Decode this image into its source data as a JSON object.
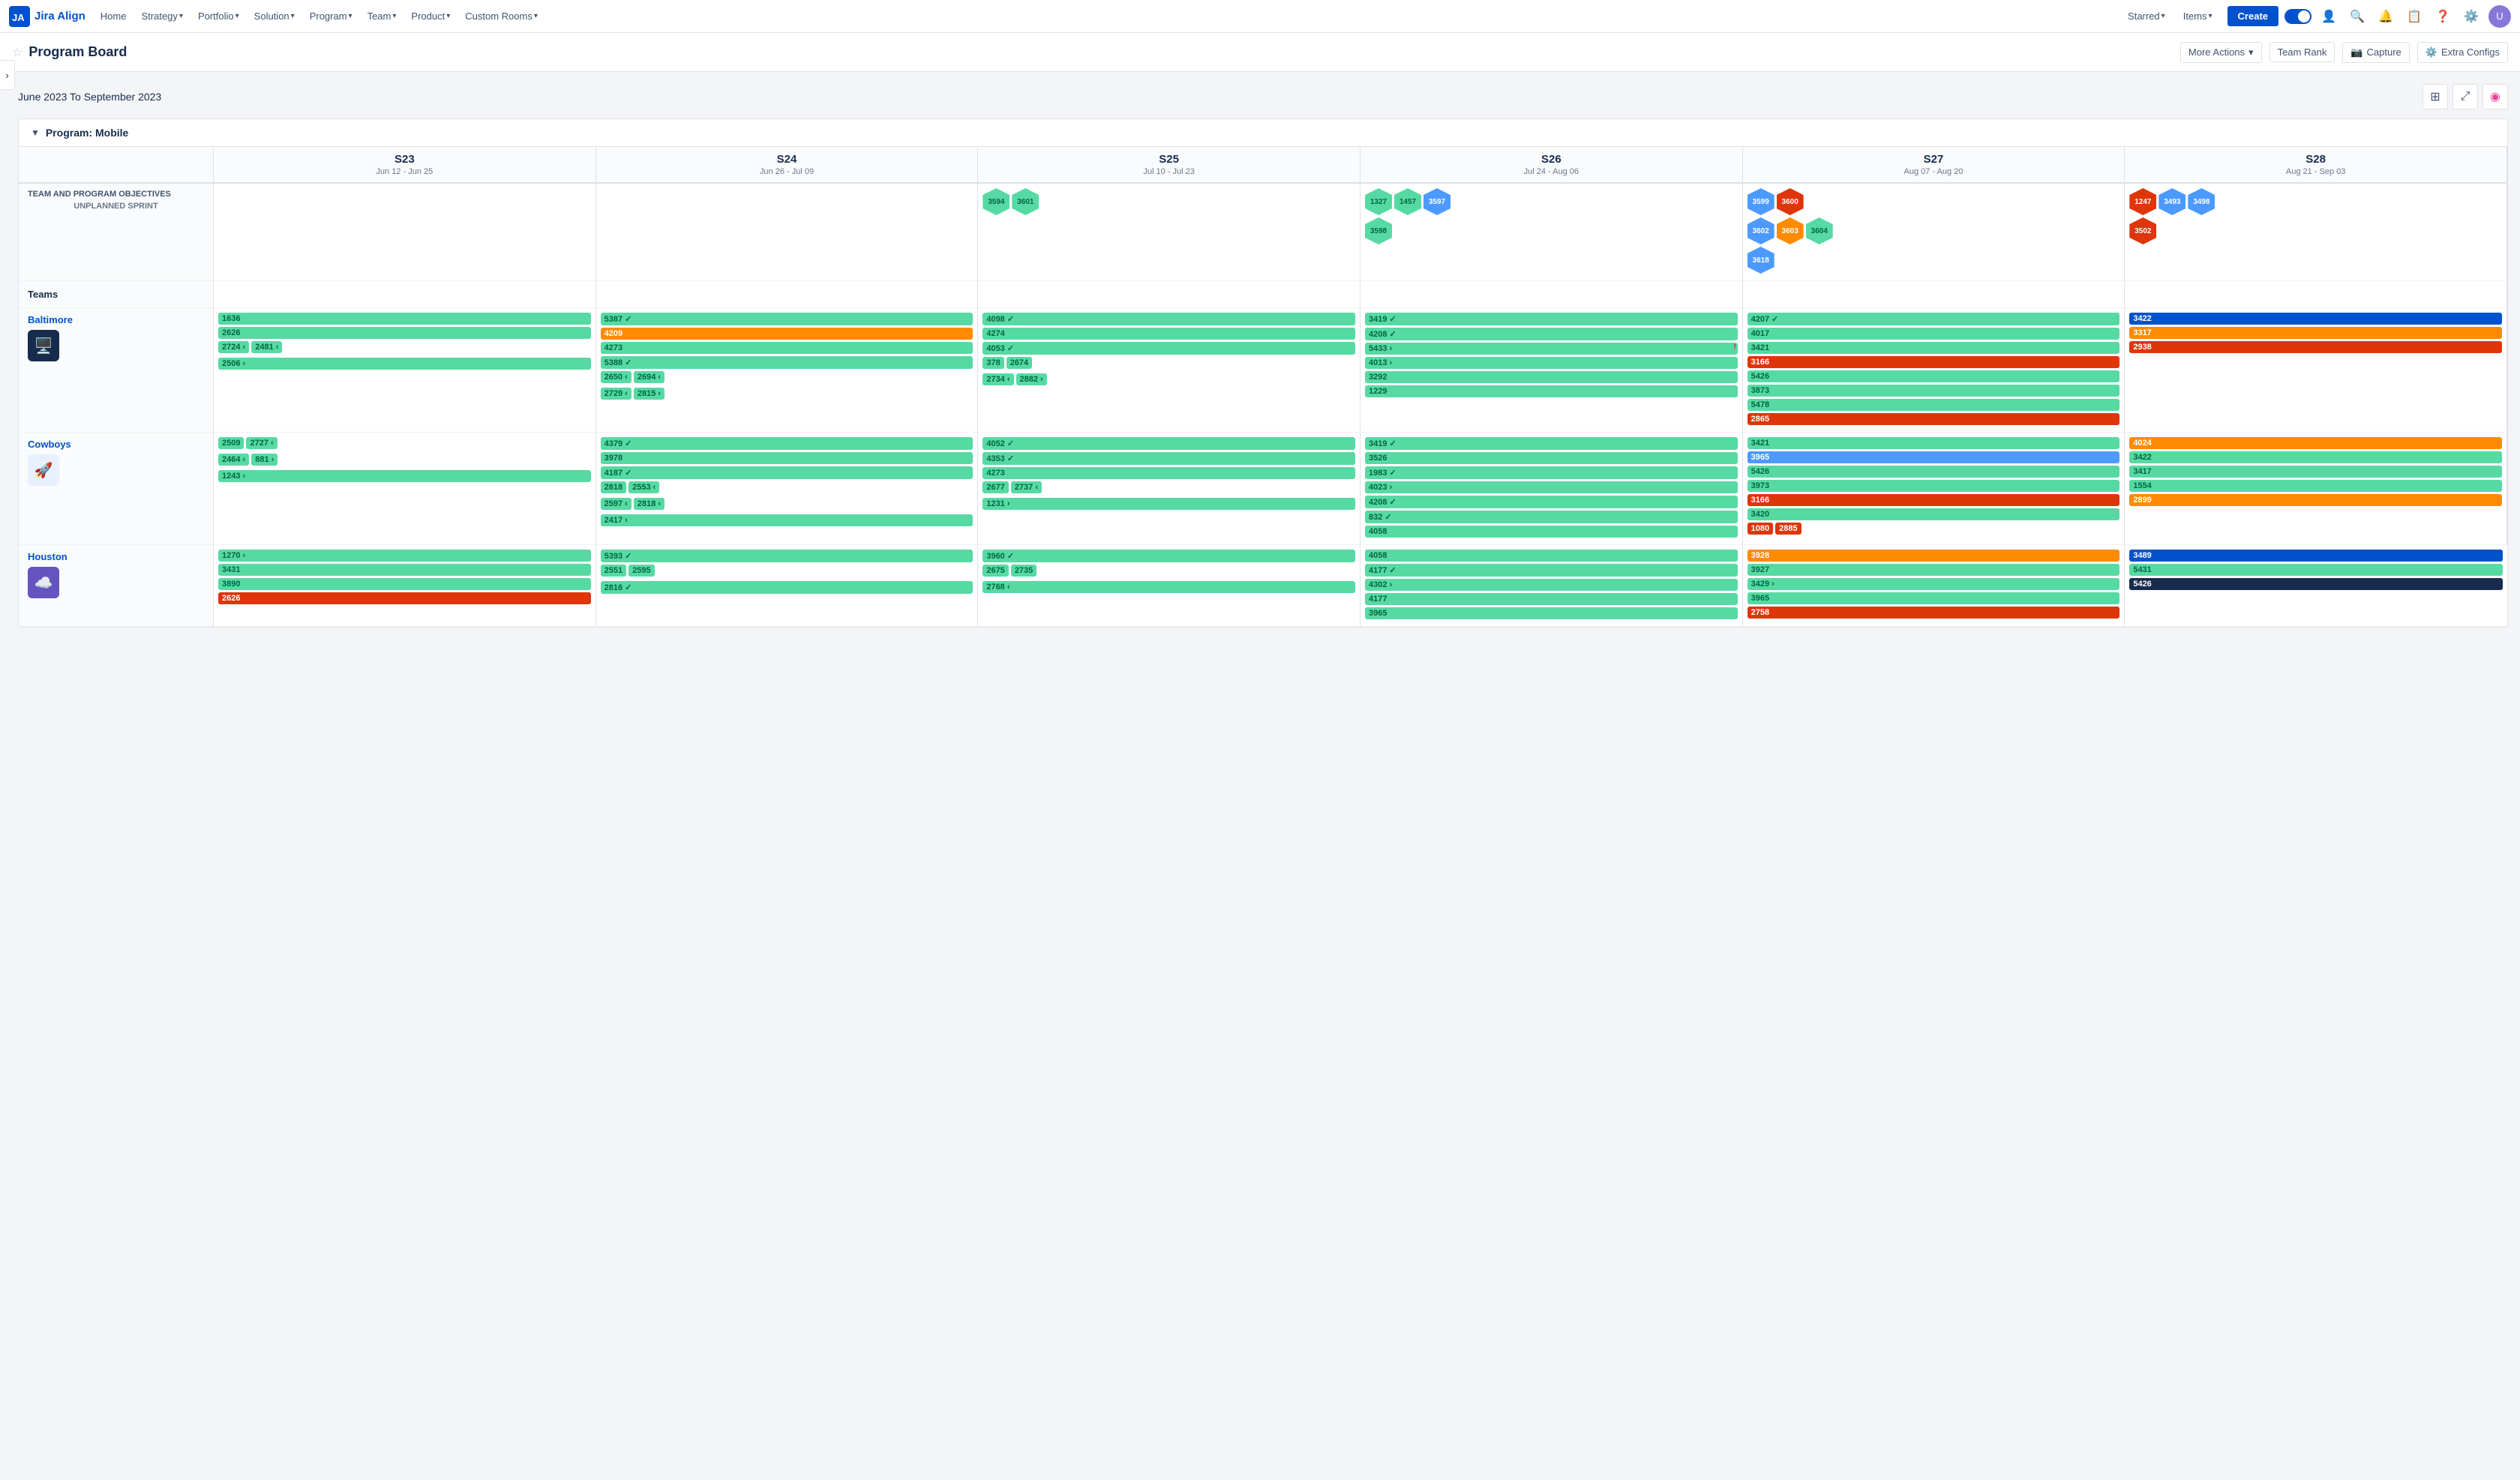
{
  "app": {
    "name": "Jira Align"
  },
  "nav": {
    "home": "Home",
    "strategy": "Strategy",
    "portfolio": "Portfolio",
    "solution": "Solution",
    "program": "Program",
    "team": "Team",
    "product": "Product",
    "customRooms": "Custom Rooms",
    "starred": "Starred",
    "items": "Items",
    "create": "Create"
  },
  "pageHeader": {
    "title": "Program Board",
    "moreActions": "More Actions",
    "teamRank": "Team Rank",
    "capture": "Capture",
    "extraConfigs": "Extra Configs"
  },
  "board": {
    "dateRange": "June 2023 To September 2023",
    "programName": "Program: Mobile",
    "unplannedSprint": "Unplanned Sprint",
    "sections": {
      "objectives": "Team and Program Objectives",
      "teams": "Teams"
    },
    "sprints": [
      {
        "label": "S23",
        "dates": "Jun 12 - Jun 25"
      },
      {
        "label": "S24",
        "dates": "Jun 26 - Jul 09"
      },
      {
        "label": "S25",
        "dates": "Jul 10 - Jul 23"
      },
      {
        "label": "S26",
        "dates": "Jul 24 - Aug 06"
      },
      {
        "label": "S27",
        "dates": "Aug 07 - Aug 20"
      },
      {
        "label": "S28",
        "dates": "Aug 21 - Sep 03"
      }
    ],
    "teams": [
      {
        "name": "Baltimore",
        "avatar": "🖥️",
        "avatarClass": "team-avatar-baltimore",
        "sprints": [
          {
            "cards": [
              [
                {
                  "id": "1636",
                  "color": "card-green"
                }
              ],
              [
                {
                  "id": "2626",
                  "color": "card-green"
                }
              ],
              [
                {
                  "id": "2724",
                  "color": "card-green",
                  "arrow": "‹"
                },
                {
                  "id": "2481",
                  "color": "card-green",
                  "arrow": "‹"
                }
              ],
              [
                {
                  "id": "2506",
                  "color": "card-green",
                  "arrow": "‹"
                }
              ]
            ]
          },
          {
            "cards": [
              [
                {
                  "id": "5387",
                  "color": "card-green",
                  "arrow": "✓"
                }
              ],
              [
                {
                  "id": "4209",
                  "color": "card-orange"
                }
              ],
              [
                {
                  "id": "4273",
                  "color": "card-green"
                }
              ],
              [
                {
                  "id": "5388",
                  "color": "card-green",
                  "arrow": "✓"
                }
              ],
              [
                {
                  "id": "2650",
                  "color": "card-green",
                  "arrow": "‹"
                },
                {
                  "id": "2694",
                  "color": "card-green",
                  "arrow": "‹"
                }
              ],
              [
                {
                  "id": "2729",
                  "color": "card-green",
                  "arrow": "‹"
                },
                {
                  "id": "2815",
                  "color": "card-green",
                  "arrow": "‹"
                }
              ]
            ]
          },
          {
            "cards": [
              [
                {
                  "id": "4098",
                  "color": "card-green",
                  "arrow": "✓"
                }
              ],
              [
                {
                  "id": "4274",
                  "color": "card-green"
                }
              ],
              [
                {
                  "id": "4053",
                  "color": "card-green",
                  "arrow": "✓"
                }
              ],
              [
                {
                  "id": "378",
                  "color": "card-green"
                },
                {
                  "id": "2674",
                  "color": "card-green"
                }
              ],
              [
                {
                  "id": "2734",
                  "color": "card-green",
                  "arrow": "‹"
                },
                {
                  "id": "2882",
                  "color": "card-green",
                  "arrow": "›"
                }
              ]
            ]
          },
          {
            "cards": [
              [
                {
                  "id": "3419",
                  "color": "card-green",
                  "arrow": "✓"
                }
              ],
              [
                {
                  "id": "4208",
                  "color": "card-green",
                  "arrow": "✓"
                }
              ],
              [
                {
                  "id": "5433",
                  "color": "card-green",
                  "arrow": "›"
                }
              ],
              [
                {
                  "id": "4013",
                  "color": "card-green",
                  "arrow": "›"
                }
              ],
              [
                {
                  "id": "3292",
                  "color": "card-green"
                }
              ],
              [
                {
                  "id": "1229",
                  "color": "card-green"
                }
              ]
            ]
          },
          {
            "cards": [
              [
                {
                  "id": "4207",
                  "color": "card-green",
                  "arrow": "✓"
                }
              ],
              [
                {
                  "id": "4017",
                  "color": "card-green"
                }
              ],
              [
                {
                  "id": "3421",
                  "color": "card-green"
                }
              ],
              [
                {
                  "id": "3166",
                  "color": "card-red"
                }
              ],
              [
                {
                  "id": "5426",
                  "color": "card-green"
                }
              ],
              [
                {
                  "id": "3873",
                  "color": "card-green"
                }
              ],
              [
                {
                  "id": "5478",
                  "color": "card-green"
                }
              ],
              [
                {
                  "id": "2865",
                  "color": "card-red"
                }
              ]
            ]
          },
          {
            "cards": [
              [
                {
                  "id": "3422",
                  "color": "card-blue"
                }
              ],
              [
                {
                  "id": "3317",
                  "color": "card-orange"
                }
              ],
              [
                {
                  "id": "2938",
                  "color": "card-red"
                }
              ]
            ]
          }
        ]
      },
      {
        "name": "Cowboys",
        "avatar": "🚀",
        "avatarClass": "team-avatar-cowboys",
        "sprints": [
          {
            "cards": [
              [
                {
                  "id": "2509",
                  "color": "card-green"
                },
                {
                  "id": "2727",
                  "color": "card-green",
                  "arrow": "‹"
                }
              ],
              [
                {
                  "id": "2464",
                  "color": "card-green",
                  "arrow": "‹"
                },
                {
                  "id": "881",
                  "color": "card-green",
                  "arrow": "›"
                }
              ],
              [
                {
                  "id": "1243",
                  "color": "card-green",
                  "arrow": "›"
                }
              ]
            ]
          },
          {
            "cards": [
              [
                {
                  "id": "4379",
                  "color": "card-green",
                  "arrow": "✓"
                }
              ],
              [
                {
                  "id": "3978",
                  "color": "card-green"
                }
              ],
              [
                {
                  "id": "4187",
                  "color": "card-green",
                  "arrow": "✓"
                }
              ],
              [
                {
                  "id": "2818",
                  "color": "card-green"
                },
                {
                  "id": "2553",
                  "color": "card-green",
                  "arrow": "‹"
                }
              ],
              [
                {
                  "id": "2597",
                  "color": "card-green",
                  "arrow": "‹"
                },
                {
                  "id": "2818",
                  "color": "card-green",
                  "arrow": "‹"
                }
              ],
              [
                {
                  "id": "2417",
                  "color": "card-green",
                  "arrow": "›"
                }
              ]
            ]
          },
          {
            "cards": [
              [
                {
                  "id": "4052",
                  "color": "card-green",
                  "arrow": "✓"
                }
              ],
              [
                {
                  "id": "4353",
                  "color": "card-green",
                  "arrow": "✓"
                }
              ],
              [
                {
                  "id": "4273",
                  "color": "card-green"
                }
              ],
              [
                {
                  "id": "2677",
                  "color": "card-green"
                },
                {
                  "id": "2737",
                  "color": "card-green",
                  "arrow": "‹"
                }
              ],
              [
                {
                  "id": "1231",
                  "color": "card-green",
                  "arrow": "›"
                }
              ]
            ]
          },
          {
            "cards": [
              [
                {
                  "id": "3419",
                  "color": "card-green",
                  "arrow": "✓"
                }
              ],
              [
                {
                  "id": "3526",
                  "color": "card-green"
                }
              ],
              [
                {
                  "id": "1983",
                  "color": "card-green",
                  "arrow": "✓"
                }
              ],
              [
                {
                  "id": "4023",
                  "color": "card-green",
                  "arrow": "›"
                }
              ],
              [
                {
                  "id": "4208",
                  "color": "card-green",
                  "arrow": "✓"
                }
              ],
              [
                {
                  "id": "832",
                  "color": "card-green",
                  "arrow": "✓"
                }
              ],
              [
                {
                  "id": "4058",
                  "color": "card-green"
                }
              ]
            ]
          },
          {
            "cards": [
              [
                {
                  "id": "3421",
                  "color": "card-green"
                }
              ],
              [
                {
                  "id": "3965",
                  "color": "card-blue-light"
                }
              ],
              [
                {
                  "id": "5426",
                  "color": "card-green"
                }
              ],
              [
                {
                  "id": "3973",
                  "color": "card-green"
                }
              ],
              [
                {
                  "id": "3166",
                  "color": "card-red"
                }
              ],
              [
                {
                  "id": "3420",
                  "color": "card-green"
                }
              ],
              [
                {
                  "id": "1080",
                  "color": "card-red"
                },
                {
                  "id": "2885",
                  "color": "card-red"
                }
              ]
            ]
          },
          {
            "cards": [
              [
                {
                  "id": "4024",
                  "color": "card-orange"
                }
              ],
              [
                {
                  "id": "3422",
                  "color": "card-green"
                }
              ],
              [
                {
                  "id": "3417",
                  "color": "card-green"
                }
              ],
              [
                {
                  "id": "1554",
                  "color": "card-green"
                }
              ],
              [
                {
                  "id": "2899",
                  "color": "card-orange"
                }
              ]
            ]
          }
        ]
      },
      {
        "name": "Houston",
        "avatar": "☁️",
        "avatarClass": "team-avatar-houston",
        "sprints": [
          {
            "cards": [
              [
                {
                  "id": "1270",
                  "color": "card-green",
                  "arrow": "›"
                }
              ],
              [
                {
                  "id": "3431",
                  "color": "card-green"
                }
              ],
              [
                {
                  "id": "3890",
                  "color": "card-green"
                }
              ],
              [
                {
                  "id": "2626",
                  "color": "card-red",
                  "arrow": "!"
                }
              ]
            ]
          },
          {
            "cards": [
              [
                {
                  "id": "5393",
                  "color": "card-green",
                  "arrow": "✓"
                }
              ],
              [
                {
                  "id": "2551",
                  "color": "card-green"
                },
                {
                  "id": "2595",
                  "color": "card-green"
                }
              ],
              [
                {
                  "id": "2816",
                  "color": "card-green",
                  "arrow": "✓"
                }
              ]
            ]
          },
          {
            "cards": [
              [
                {
                  "id": "3960",
                  "color": "card-green",
                  "arrow": "✓"
                }
              ],
              [
                {
                  "id": "2675",
                  "color": "card-green"
                },
                {
                  "id": "2735",
                  "color": "card-green"
                }
              ],
              [
                {
                  "id": "2768",
                  "color": "card-green",
                  "arrow": "‹"
                }
              ]
            ]
          },
          {
            "cards": [
              [
                {
                  "id": "4058",
                  "color": "card-green"
                }
              ],
              [
                {
                  "id": "4177",
                  "color": "card-green",
                  "arrow": "✓"
                }
              ],
              [
                {
                  "id": "4302",
                  "color": "card-green",
                  "arrow": "›"
                }
              ],
              [
                {
                  "id": "4177",
                  "color": "card-green"
                }
              ],
              [
                {
                  "id": "3965",
                  "color": "card-green"
                }
              ]
            ]
          },
          {
            "cards": [
              [
                {
                  "id": "3928",
                  "color": "card-orange"
                }
              ],
              [
                {
                  "id": "3927",
                  "color": "card-green"
                }
              ],
              [
                {
                  "id": "3429",
                  "color": "card-green",
                  "arrow": "›"
                }
              ],
              [
                {
                  "id": "3965",
                  "color": "card-green"
                }
              ],
              [
                {
                  "id": "2758",
                  "color": "card-red"
                }
              ]
            ]
          },
          {
            "cards": [
              [
                {
                  "id": "3489",
                  "color": "card-blue"
                }
              ],
              [
                {
                  "id": "5431",
                  "color": "card-green"
                }
              ],
              [
                {
                  "id": "5426",
                  "color": "card-dark"
                }
              ]
            ]
          }
        ]
      }
    ],
    "objectives": {
      "s23": [],
      "s24": [],
      "s25": [
        {
          "id": "3594",
          "color": "hex-green"
        },
        {
          "id": "3601",
          "color": "hex-green"
        }
      ],
      "s26": [
        {
          "id": "1327",
          "color": "hex-green"
        },
        {
          "id": "1457",
          "color": "hex-green"
        },
        {
          "id": "3597",
          "color": "hex-blue"
        },
        {
          "id": "3598",
          "color": "hex-green"
        }
      ],
      "s27": [
        {
          "id": "3599",
          "color": "hex-blue"
        },
        {
          "id": "3600",
          "color": "hex-red"
        },
        {
          "id": "3602",
          "color": "hex-blue"
        },
        {
          "id": "3603",
          "color": "hex-orange"
        },
        {
          "id": "3604",
          "color": "hex-green"
        },
        {
          "id": "3618",
          "color": "hex-blue"
        }
      ],
      "s28": [
        {
          "id": "1247",
          "color": "hex-red"
        },
        {
          "id": "3493",
          "color": "hex-blue"
        },
        {
          "id": "3498",
          "color": "hex-blue"
        },
        {
          "id": "3502",
          "color": "hex-red"
        }
      ]
    }
  }
}
